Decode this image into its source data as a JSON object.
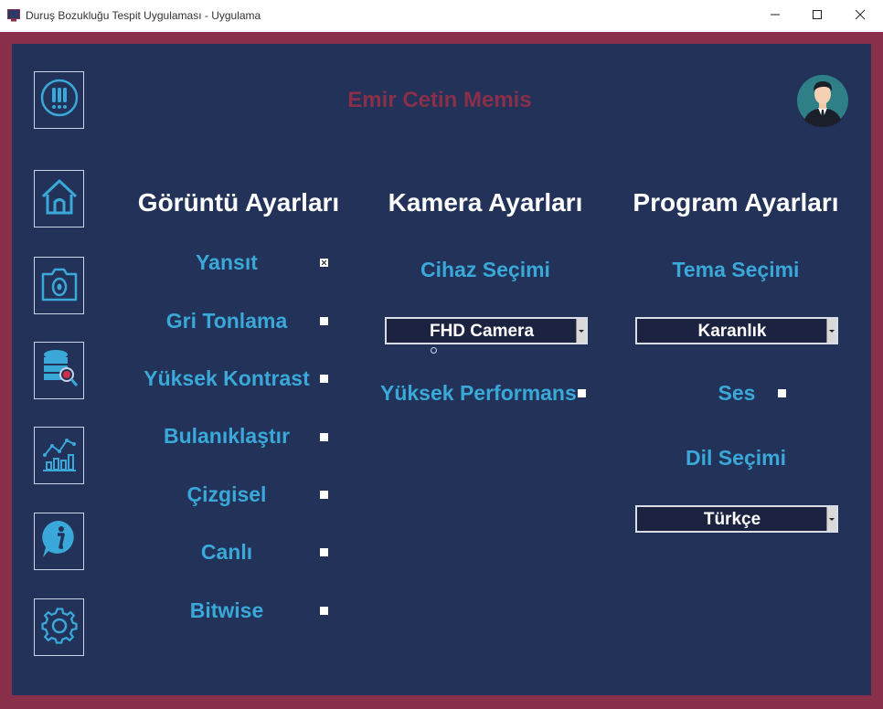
{
  "window": {
    "title": "Duruş Bozukluğu Tespit Uygulaması - Uygulama",
    "controls": [
      "minimize-icon",
      "maximize-icon",
      "close-icon"
    ]
  },
  "header": {
    "user_name": "Emir Cetin Memis"
  },
  "sidebar": {
    "items": [
      {
        "icon": "alert-icon"
      },
      {
        "icon": "home-icon"
      },
      {
        "icon": "camera-icon"
      },
      {
        "icon": "database-search-icon"
      },
      {
        "icon": "statistics-chart-icon"
      },
      {
        "icon": "info-icon"
      },
      {
        "icon": "settings-gear-icon"
      }
    ]
  },
  "image_settings": {
    "title": "Görüntü Ayarları",
    "options": [
      {
        "label": "Yansıt",
        "checked": true
      },
      {
        "label": "Gri Tonlama",
        "checked": false
      },
      {
        "label": "Yüksek Kontrast",
        "checked": false
      },
      {
        "label": "Bulanıklaştır",
        "checked": false
      },
      {
        "label": "Çizgisel",
        "checked": false
      },
      {
        "label": "Canlı",
        "checked": false
      },
      {
        "label": "Bitwise",
        "checked": false
      }
    ]
  },
  "camera_settings": {
    "title": "Kamera Ayarları",
    "device_label": "Cihaz Seçimi",
    "device_value": "FHD Camera",
    "performance_label": "Yüksek Performans",
    "performance_checked": false
  },
  "program_settings": {
    "title": "Program Ayarları",
    "theme_label": "Tema Seçimi",
    "theme_value": "Karanlık",
    "sound_label": "Ses",
    "sound_checked": false,
    "language_label": "Dil Seçimi",
    "language_value": "Türkçe"
  },
  "colors": {
    "frame": "#8a2f4a",
    "panel": "#223258",
    "accent_text": "#3aa8d8",
    "name_text": "#8a2f4a"
  }
}
